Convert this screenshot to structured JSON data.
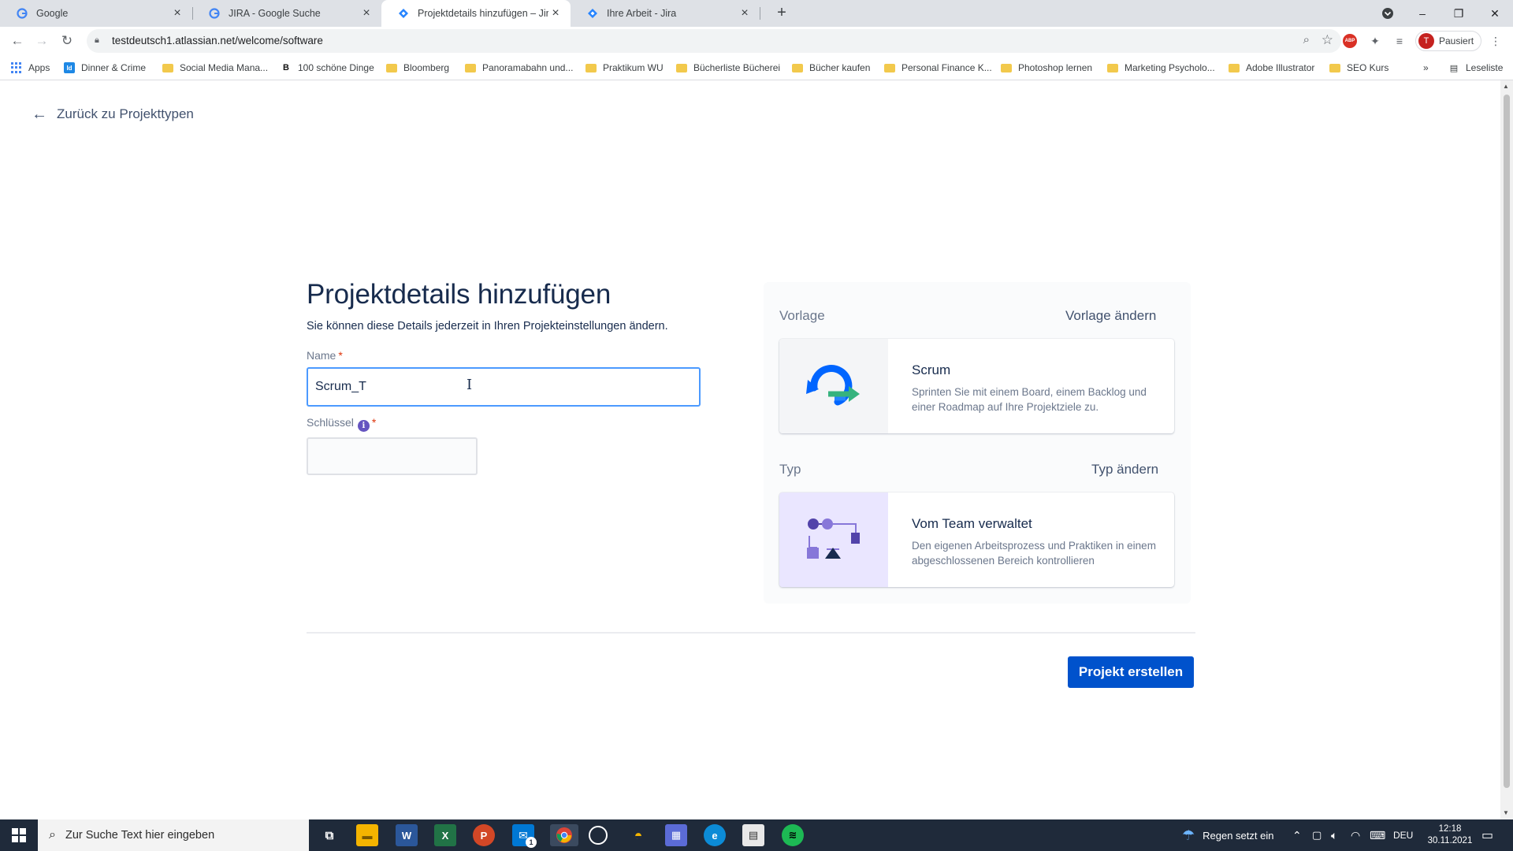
{
  "browser": {
    "tabs": [
      {
        "title": "Google",
        "favicon": "google-g-icon",
        "active": false
      },
      {
        "title": "JIRA - Google Suche",
        "favicon": "google-g-icon",
        "active": false
      },
      {
        "title": "Projektdetails hinzufügen – Jira",
        "favicon": "jira-icon",
        "active": true
      },
      {
        "title": "Ihre Arbeit - Jira",
        "favicon": "jira-icon",
        "active": false
      }
    ],
    "url": "testdeutsch1.atlassian.net/welcome/software",
    "profile_label": "Pausiert",
    "profile_initial": "T",
    "bookmarks": [
      {
        "label": "Apps"
      },
      {
        "label": "Dinner & Crime"
      },
      {
        "label": "Social Media Mana..."
      },
      {
        "label": "100 schöne Dinge"
      },
      {
        "label": "Bloomberg"
      },
      {
        "label": "Panoramabahn und..."
      },
      {
        "label": "Praktikum WU"
      },
      {
        "label": "Bücherliste Bücherei"
      },
      {
        "label": "Bücher kaufen"
      },
      {
        "label": "Personal Finance K..."
      },
      {
        "label": "Photoshop lernen"
      },
      {
        "label": "Marketing Psycholo..."
      },
      {
        "label": "Adobe Illustrator"
      },
      {
        "label": "SEO Kurs"
      }
    ],
    "reading_list": "Leseliste",
    "ext_abp": "ABP"
  },
  "page": {
    "back_link": "Zurück zu Projekttypen",
    "title": "Projektdetails hinzufügen",
    "subtitle": "Sie können diese Details jederzeit in Ihren Projekteinstellungen ändern.",
    "name_label": "Name",
    "name_value": "Scrum_T",
    "key_label": "Schlüssel",
    "required_mark": "*",
    "info_glyph": "i",
    "template_label": "Vorlage",
    "template_action": "Vorlage ändern",
    "template_card": {
      "title": "Scrum",
      "description": "Sprinten Sie mit einem Board, einem Backlog und einer Roadmap auf Ihre Projektziele zu."
    },
    "type_label": "Typ",
    "type_action": "Typ ändern",
    "type_card": {
      "title": "Vom Team verwaltet",
      "description": "Den eigenen Arbeitsprozess und Praktiken in einem abgeschlossenen Bereich kontrollieren"
    },
    "create_button": "Projekt erstellen"
  },
  "taskbar": {
    "search_placeholder": "Zur Suche Text hier eingeben",
    "weather": "Regen setzt ein",
    "language": "DEU",
    "time": "12:18",
    "date": "30.11.2021",
    "mail_badge": "1"
  },
  "colors": {
    "primary": "#0052CC",
    "focus_border": "#4C9AFF",
    "text": "#172B4D",
    "subtle_text": "#6B778C"
  }
}
